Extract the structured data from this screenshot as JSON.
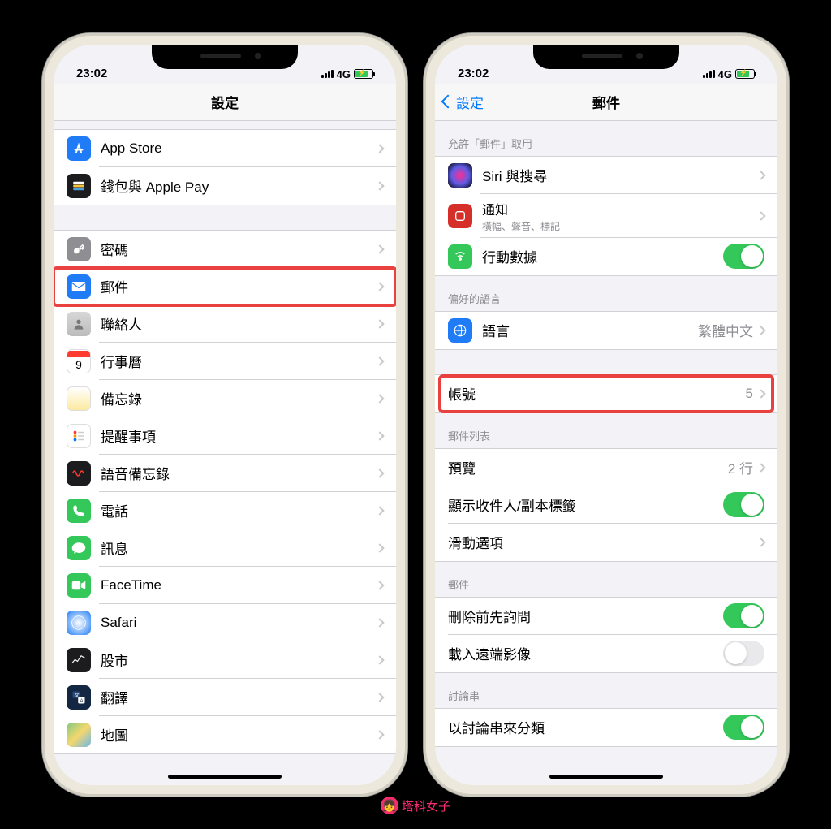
{
  "status": {
    "time": "23:02",
    "network": "4G"
  },
  "left": {
    "title": "設定",
    "items": {
      "appstore": "App Store",
      "wallet": "錢包與 Apple Pay",
      "passwords": "密碼",
      "mail": "郵件",
      "contacts": "聯絡人",
      "calendar": "行事曆",
      "notes": "備忘錄",
      "reminders": "提醒事項",
      "voicememos": "語音備忘錄",
      "phone": "電話",
      "messages": "訊息",
      "facetime": "FaceTime",
      "safari": "Safari",
      "stocks": "股市",
      "translate": "翻譯",
      "maps": "地圖"
    }
  },
  "right": {
    "back": "設定",
    "title": "郵件",
    "section_allow": "允許「郵件」取用",
    "siri": "Siri 與搜尋",
    "notifications": {
      "label": "通知",
      "sub": "橫幅、聲音、標記"
    },
    "cellular": "行動數據",
    "section_lang": "偏好的語言",
    "language": {
      "label": "語言",
      "value": "繁體中文"
    },
    "accounts": {
      "label": "帳號",
      "value": "5"
    },
    "section_list": "郵件列表",
    "preview": {
      "label": "預覽",
      "value": "2 行"
    },
    "showto": "顯示收件人/副本標籤",
    "swipe": "滑動選項",
    "section_mail": "郵件",
    "askdelete": "刪除前先詢問",
    "loadremote": "載入遠端影像",
    "section_thread": "討論串",
    "thread": "以討論串來分類"
  },
  "watermark": "塔科女子"
}
